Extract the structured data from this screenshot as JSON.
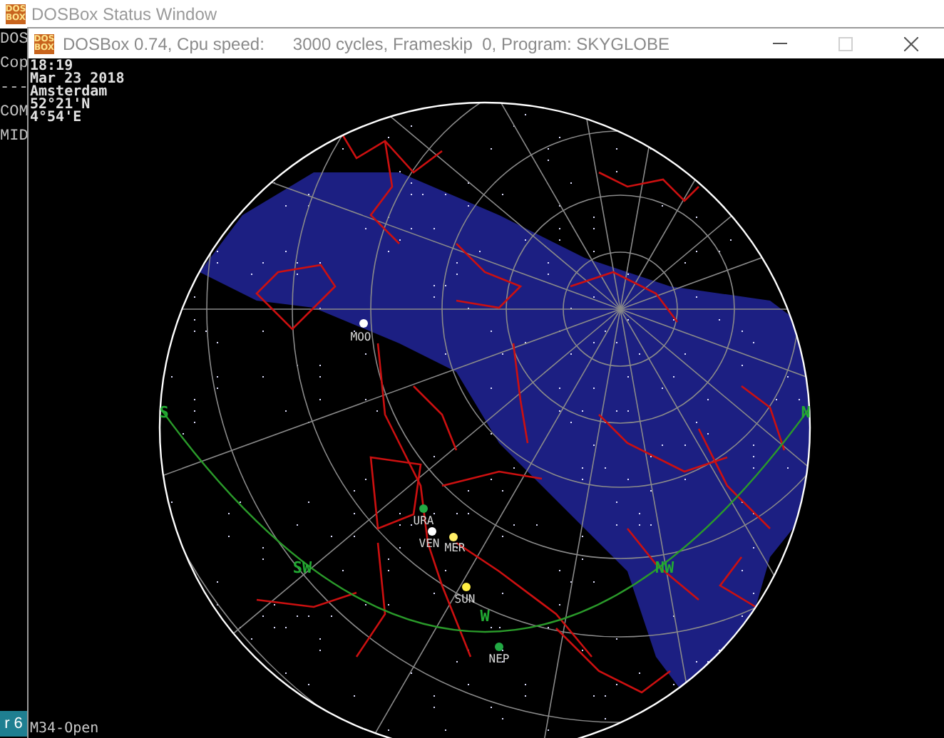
{
  "status_window": {
    "title": "DOSBox Status Window",
    "icon_lines": [
      "DOS",
      "BOX"
    ],
    "console_lines": [
      "DOS",
      "Cop",
      "---",
      "COM",
      "MID"
    ],
    "taskbar_text": "r 6"
  },
  "window": {
    "title": "DOSBox 0.74, Cpu speed:      3000 cycles, Frameskip  0, Program: SKYGLOBE",
    "icon_lines": [
      "DOS",
      "BOX"
    ],
    "maximize_disabled": true
  },
  "info_lines": [
    "18:19",
    "Mar 23 2018",
    "Amsterdam",
    "52°21'N",
    "4°54'E"
  ],
  "horizon_labels": [
    "S",
    "SW",
    "W",
    "NW",
    "N"
  ],
  "objects": [
    {
      "label": "MOO",
      "color": "#ffffff"
    },
    {
      "label": "URA",
      "color": "#22aa44"
    },
    {
      "label": "VEN",
      "color": "#ffffff"
    },
    {
      "label": "MER",
      "color": "#ffee66"
    },
    {
      "label": "SUN",
      "color": "#ffee44"
    },
    {
      "label": "NEP",
      "color": "#22aa44"
    }
  ],
  "status_text": "M34-Open"
}
